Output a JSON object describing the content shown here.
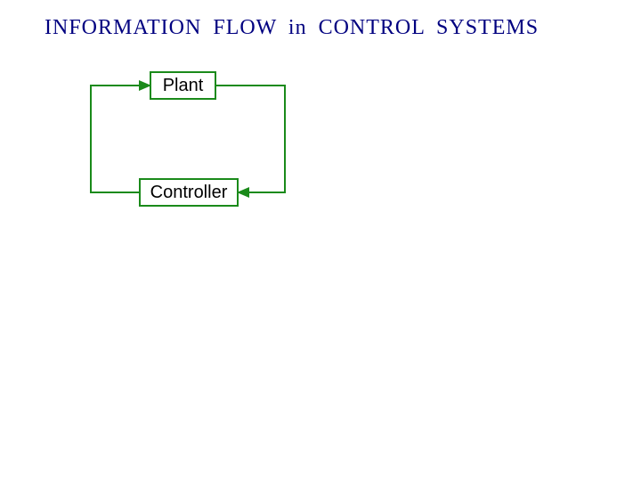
{
  "title": "INFORMATION  FLOW  in  CONTROL  SYSTEMS",
  "blocks": {
    "plant": "Plant",
    "controller": "Controller"
  },
  "colors": {
    "title": "#000080",
    "line": "#1a8a1a"
  }
}
